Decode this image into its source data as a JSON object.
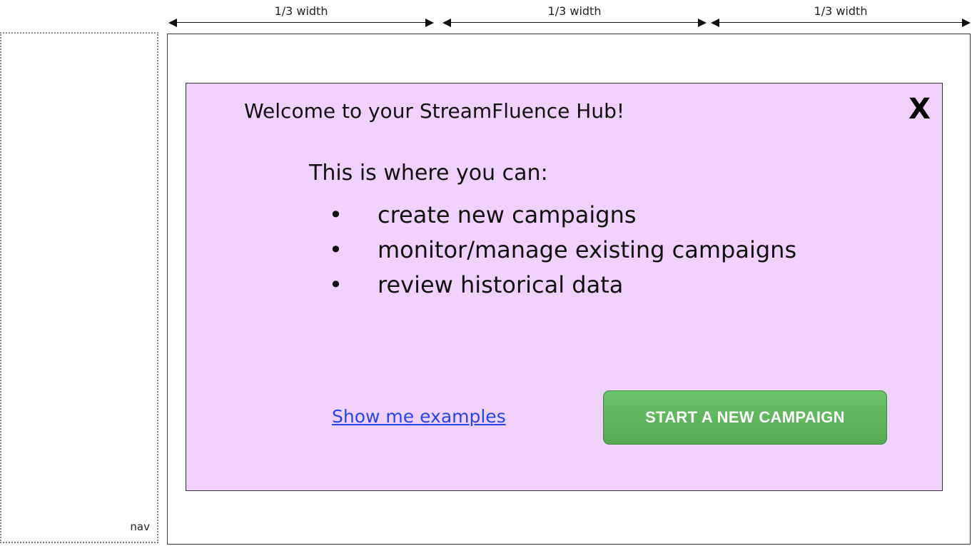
{
  "annotations": {
    "column_labels": [
      "1/3  width",
      "1/3  width",
      "1/3  width"
    ],
    "nav_label": "nav"
  },
  "welcome_panel": {
    "close_label": "X",
    "title": "Welcome to your StreamFluence Hub!",
    "intro": "This is where you can:",
    "bullet_glyph": "•",
    "bullets": [
      "create new campaigns",
      "monitor/manage existing campaigns",
      "review historical data"
    ],
    "examples_link": "Show me examples",
    "primary_button": "START A NEW CAMPAIGN"
  },
  "colors": {
    "panel_bg": "#f0d1fc",
    "link": "#2845e8",
    "button_green": "#5cb85a"
  }
}
